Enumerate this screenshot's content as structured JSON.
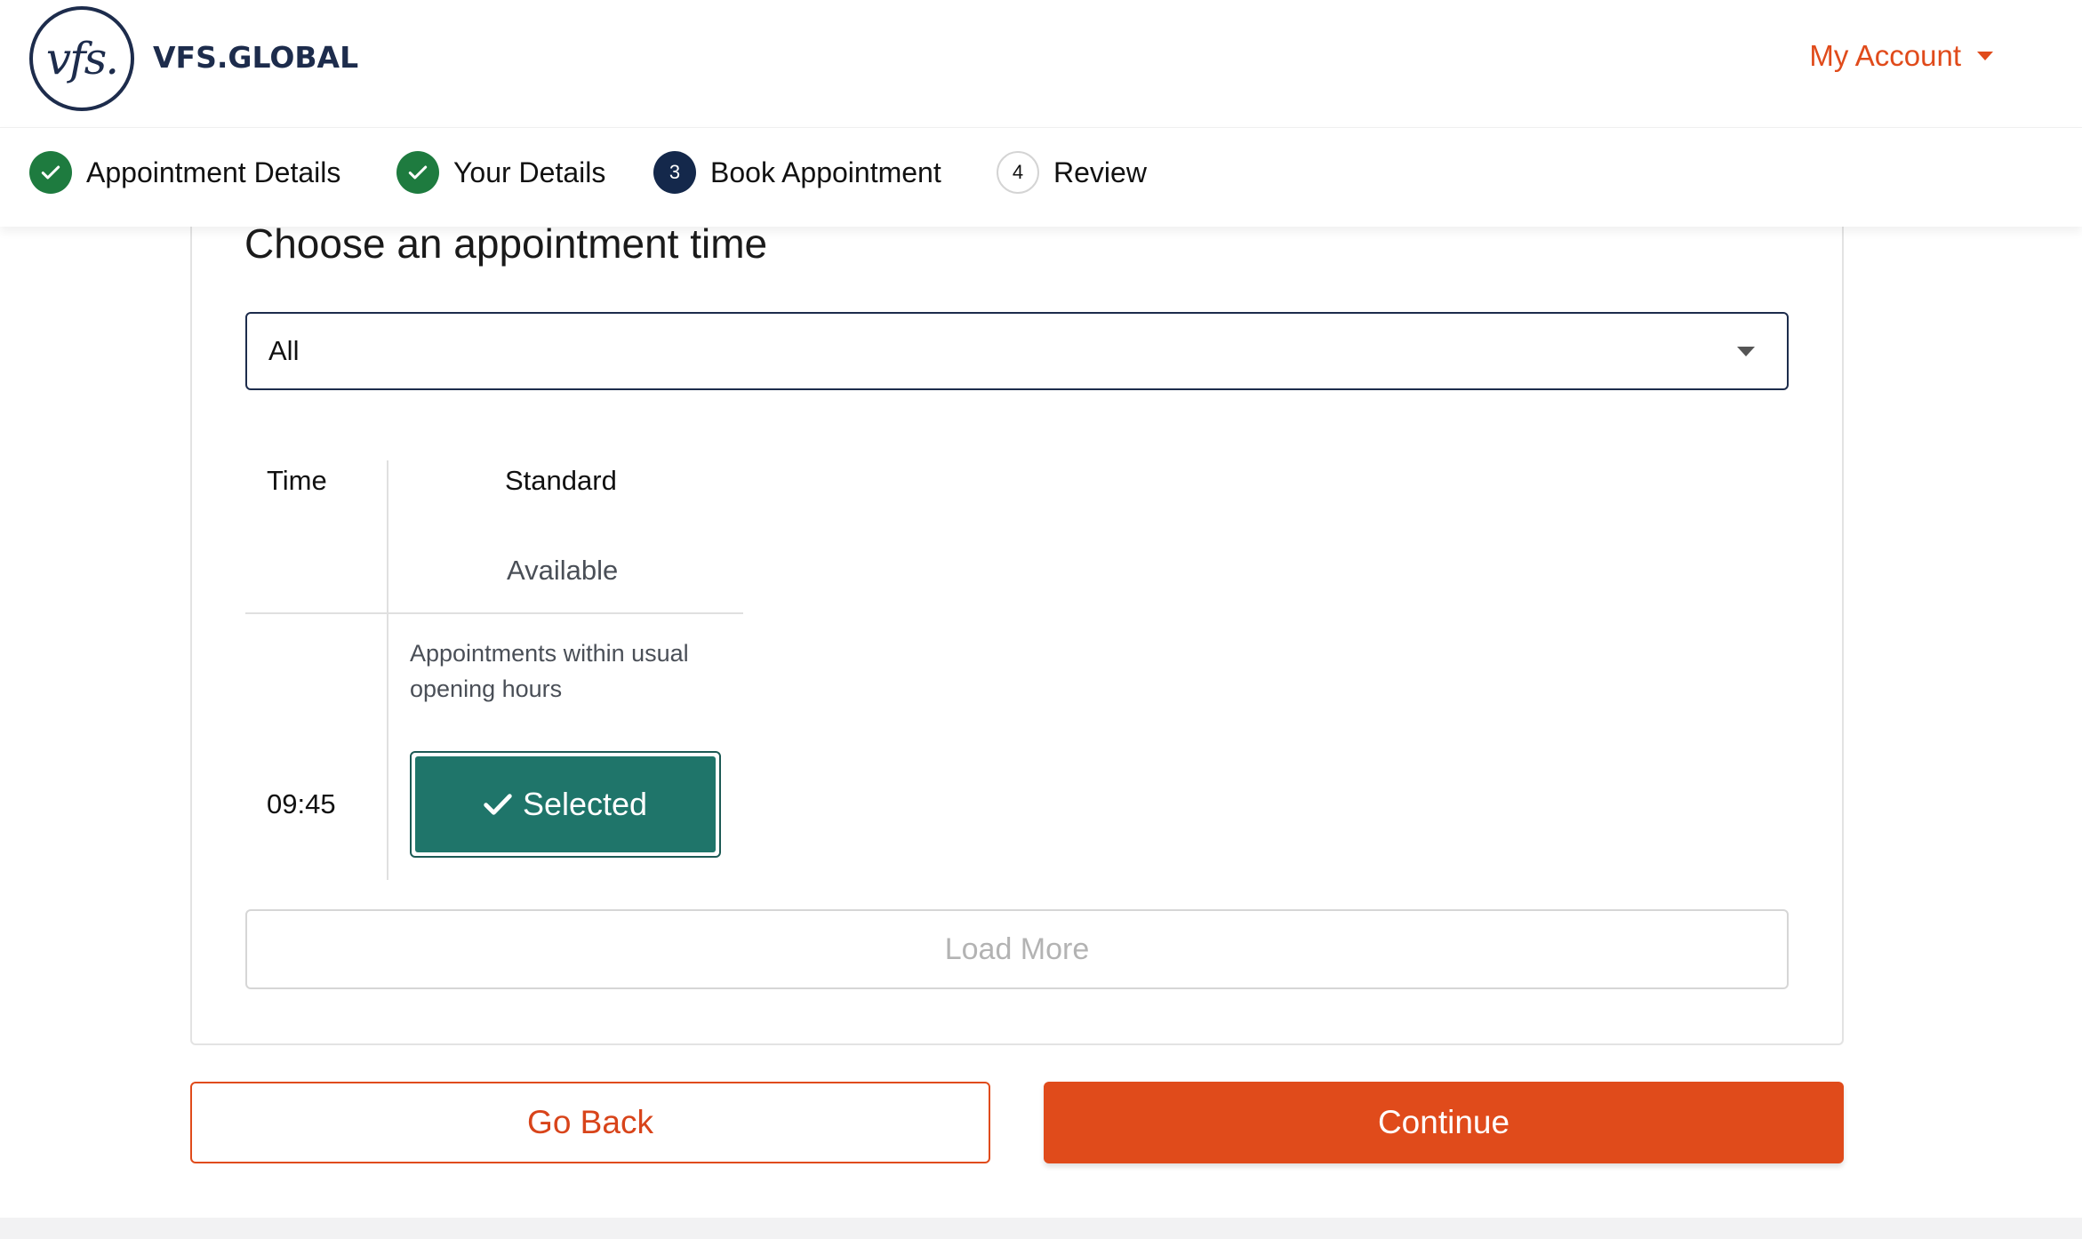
{
  "header": {
    "logo_mark": "vfs.",
    "logo_text": "VFS.GLOBAL",
    "account_label": "My Account",
    "accent_color": "#e04b1b",
    "brand_color": "#1d2c4c"
  },
  "stepper": {
    "steps": [
      {
        "label": "Appointment Details",
        "status": "completed",
        "icon": "check-icon"
      },
      {
        "label": "Your Details",
        "status": "completed",
        "icon": "check-icon"
      },
      {
        "label": "Book Appointment",
        "status": "active",
        "number": "3"
      },
      {
        "label": "Review",
        "status": "pending",
        "number": "4"
      }
    ]
  },
  "main": {
    "title": "Choose an appointment time",
    "filter": {
      "selected": "All"
    },
    "table": {
      "time_header": "Time",
      "category_header": "Standard",
      "category_status": "Available",
      "category_note": "Appointments within usual opening hours",
      "rows": [
        {
          "time": "09:45",
          "slot_label": "Selected",
          "slot_state": "selected",
          "slot_color": "#1f756a"
        }
      ]
    },
    "load_more_label": "Load More"
  },
  "actions": {
    "back_label": "Go Back",
    "continue_label": "Continue"
  }
}
